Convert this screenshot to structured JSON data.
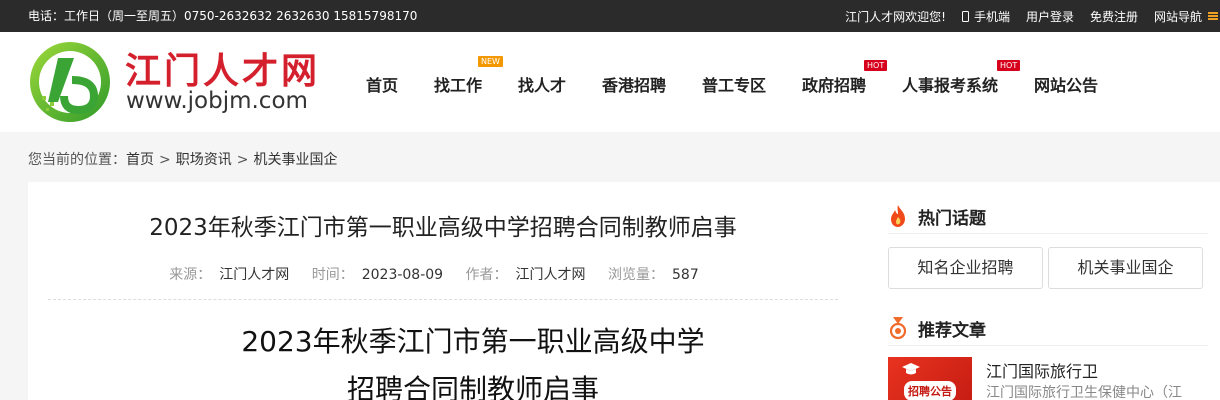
{
  "topbar": {
    "contact": "电话：工作日（周一至周五）0750-2632632 2632630 15815798170",
    "welcome": "江门人才网欢迎您!",
    "mobile": "手机端",
    "login": "用户登录",
    "register": "免费注册",
    "sitemap": "网站导航"
  },
  "logo": {
    "name": "江门人才网",
    "url": "www.jobjm.com"
  },
  "nav": {
    "items": [
      {
        "label": "首页"
      },
      {
        "label": "找工作",
        "badge": "NEW"
      },
      {
        "label": "找人才"
      },
      {
        "label": "香港招聘"
      },
      {
        "label": "普工专区"
      },
      {
        "label": "政府招聘",
        "badge": "HOT"
      },
      {
        "label": "人事报考系统",
        "badge": "HOT"
      },
      {
        "label": "网站公告"
      }
    ]
  },
  "breadcrumb": {
    "prefix": "您当前的位置：",
    "items": [
      "首页",
      "职场资讯",
      "机关事业国企"
    ],
    "separator": ">"
  },
  "article": {
    "title": "2023年秋季江门市第一职业高级中学招聘合同制教师启事",
    "meta": {
      "source_label": "来源：",
      "source": "江门人才网",
      "time_label": "时间：",
      "time": "2023-08-09",
      "author_label": "作者：",
      "author": "江门人才网",
      "views_label": "浏览量：",
      "views": "587"
    },
    "heading_line1": "2023年秋季江门市第一职业高级中学",
    "heading_line2": "招聘合同制教师启事"
  },
  "sidebar": {
    "hot_title": "热门话题",
    "hot_tags": [
      "知名企业招聘",
      "机关事业国企"
    ],
    "rec_title": "推荐文章",
    "rec_items": [
      {
        "thumb_text": "招聘公告",
        "title": "江门国际旅行卫",
        "desc": "江门国际旅行卫生保健中心（江"
      }
    ]
  },
  "colors": {
    "brand_red": "#d3202c",
    "badge_new": "#f39800",
    "badge_hot": "#d7001c",
    "logo_green": "#5cb531",
    "topbar_bg": "#2b2b2b"
  }
}
